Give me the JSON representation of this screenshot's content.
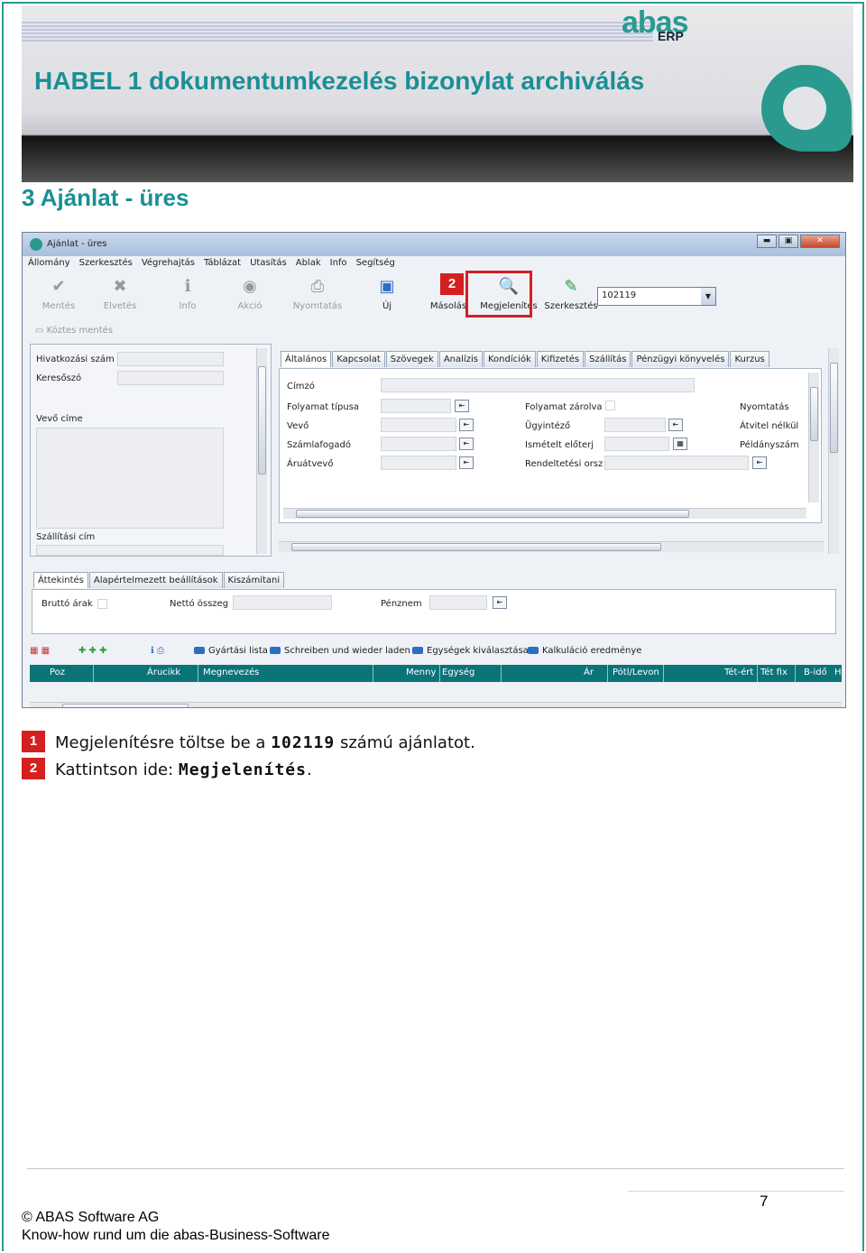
{
  "header": {
    "title": "HABEL 1 dokumentumkezelés bizonylat archiválás",
    "logo_text": "abas",
    "logo_sub": "ERP"
  },
  "section_title": "3  Ajánlat - üres",
  "app": {
    "window_title": "Ajánlat - üres",
    "window_buttons": [
      "▬",
      "▣",
      "✕"
    ],
    "menu": [
      "Állomány",
      "Szerkesztés",
      "Végrehajtás",
      "Táblázat",
      "Utasítás",
      "Ablak",
      "Info",
      "Segítség"
    ],
    "toolbar": {
      "save": "Mentés",
      "discard": "Elvetés",
      "info": "Info",
      "action": "Akció",
      "print": "Nyomtatás",
      "new": "Új",
      "copy": "Másolás",
      "display": "Megjelenítés",
      "edit": "Szerkesztés"
    },
    "record_combo_value": "102119",
    "interim_save": "Köztes mentés",
    "badge_2": "2",
    "left_panel": {
      "ref_number": "Hivatkozási szám",
      "search_word": "Keresőszó",
      "customer_address": "Vevő címe",
      "delivery_address": "Szállítási cím"
    },
    "main_tabs": [
      "Általános",
      "Kapcsolat",
      "Szövegek",
      "Analízis",
      "Kondíciók",
      "Kifizetés",
      "Szállítás",
      "Pénzügyi könyvelés",
      "Kurzus"
    ],
    "general": {
      "recipient": "Címzó",
      "process_type": "Folyamat típusa",
      "customer": "Vevő",
      "invoice_recipient": "Számlafogadó",
      "goods_recipient": "Áruátvevő",
      "process_locked": "Folyamat zárolva",
      "clerk": "Ügyintéző",
      "repeat_reg": "Ismételt előterj",
      "order_country": "Rendeltetési orsz",
      "print": "Nyomtatás",
      "no_transfer": "Átvitel nélkül",
      "copies": "Példányszám"
    },
    "bottom_tabs": [
      "Áttekintés",
      "Alapértelmezett beállítások",
      "Kiszámítani"
    ],
    "overview": {
      "gross_prices": "Bruttó árak",
      "net_total": "Nettó összeg",
      "currency": "Pénznem"
    },
    "row_toolbar": [
      "Gyártási lista",
      "Schreiben und wieder laden",
      "Egységek kiválasztása",
      "Kalkuláció eredménye"
    ],
    "grid_columns": [
      "Poz",
      "Árucikk",
      "Megnevezés",
      "Menny",
      "Egység",
      "Ár",
      "Pótl/Levon",
      "Tét-ért",
      "Tét fix",
      "B-idő",
      "H"
    ]
  },
  "steps": [
    {
      "num": "1",
      "before": "Megjelenítésre töltse be a ",
      "bold": "102119",
      "after": " számú ajánlatot."
    },
    {
      "num": "2",
      "before": "Kattintson ide: ",
      "bold": "Megjelenítés",
      "after": "."
    }
  ],
  "footer": {
    "page": "7",
    "copyright": "© ABAS Software AG",
    "tagline": "Know-how rund um die abas-Business-Software"
  },
  "colors": {
    "accent": "#1b8f94",
    "highlight": "#d42020",
    "grid_header": "#0a7478"
  }
}
